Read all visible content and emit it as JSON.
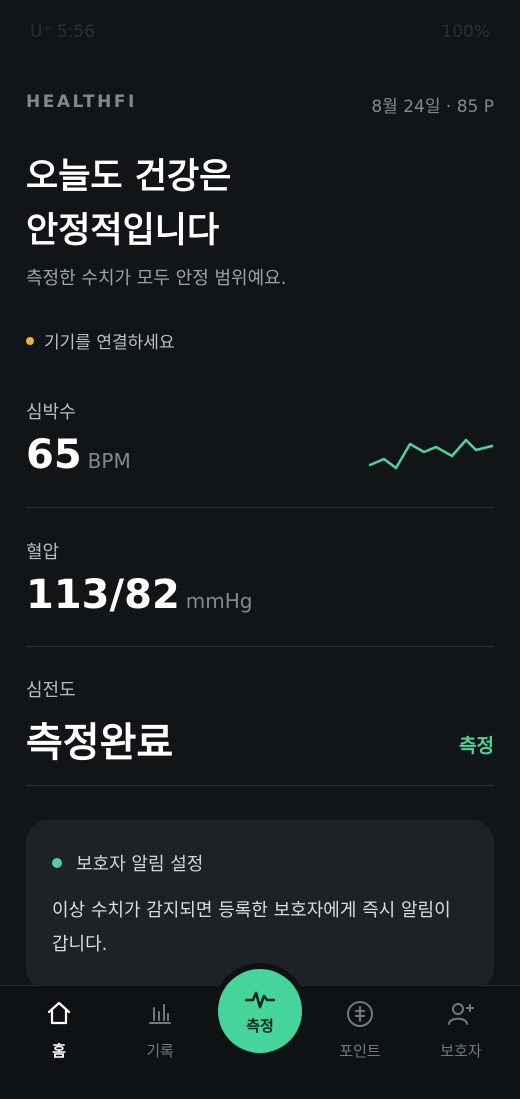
{
  "status_bar": {
    "time": "5:56",
    "carrier": "U⁺",
    "battery": "100%"
  },
  "header": {
    "brand": "HEALTHFI",
    "date": "8월 24일",
    "separator": "·",
    "points": "85 P"
  },
  "hero": {
    "title_line1": "오늘도 건강은",
    "title_line2": "안정적입니다",
    "subtitle": "측정한 수치가 모두 안정 범위예요."
  },
  "device_status": {
    "text": "기기를 연결하세요",
    "dot_color": "#f0b43c"
  },
  "metrics": {
    "heart_rate": {
      "label": "심박수",
      "value": "65",
      "unit": "BPM"
    },
    "blood_pressure": {
      "label": "혈압",
      "value": "113/82",
      "unit": "mmHg"
    },
    "ecg": {
      "label": "심전도",
      "value": "측정완료",
      "action": "측정"
    }
  },
  "guardian_card": {
    "title": "보호자 알림 설정",
    "body": "이상 수치가 감지되면 등록한 보호자에게 즉시 알림이 갑니다."
  },
  "bottom_nav": {
    "home": "홈",
    "records": "기록",
    "measure": "측정",
    "points": "포인트",
    "guardian": "보호자"
  },
  "colors": {
    "background": "#111518",
    "accent": "#45d49c",
    "warning": "#f0b43c"
  }
}
